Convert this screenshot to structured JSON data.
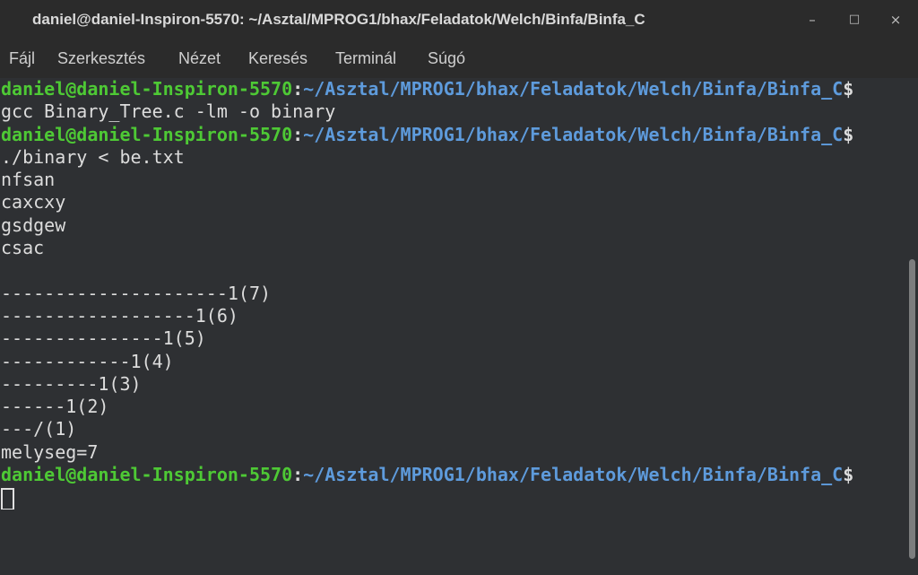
{
  "window": {
    "title": "daniel@daniel-Inspiron-5570: ~/Asztal/MPROG1/bhax/Feladatok/Welch/Binfa/Binfa_C",
    "buttons": {
      "minimize": "–",
      "maximize": "□",
      "close": "×"
    }
  },
  "menu": [
    "Fájl",
    "Szerkesztés",
    "Nézet",
    "Keresés",
    "Terminál",
    "Súgó"
  ],
  "terminal": {
    "prompt_user": "daniel@daniel-Inspiron-5570",
    "prompt_colon": ":",
    "prompt_path": "~/Asztal/MPROG1/bhax/Feladatok/Welch/Binfa/Binfa_C",
    "prompt_end": "$",
    "commands": [
      "gcc Binary_Tree.c -lm -o binary",
      "./binary < be.txt"
    ],
    "output": [
      "nfsan",
      "caxcxy",
      "gsdgew",
      "csac",
      "",
      "---------------------1(7)",
      "------------------1(6)",
      "---------------1(5)",
      "------------1(4)",
      "---------1(3)",
      "------1(2)",
      "---/(1)",
      "melyseg=7"
    ]
  }
}
